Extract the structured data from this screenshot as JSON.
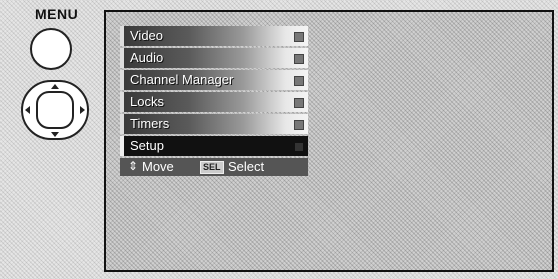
{
  "remote": {
    "menu_label": "MENU"
  },
  "menu": {
    "items": [
      {
        "label": "Video"
      },
      {
        "label": "Audio"
      },
      {
        "label": "Channel Manager"
      },
      {
        "label": "Locks"
      },
      {
        "label": "Timers"
      },
      {
        "label": "Setup",
        "selected": true
      }
    ]
  },
  "hints": {
    "move_label": "Move",
    "sel_badge": "SEL",
    "select_label": "Select"
  },
  "icons": {
    "menu_button": "circle-button-icon",
    "dpad": "directional-pad-icon",
    "move_arrow": "up-down-arrow-icon"
  }
}
